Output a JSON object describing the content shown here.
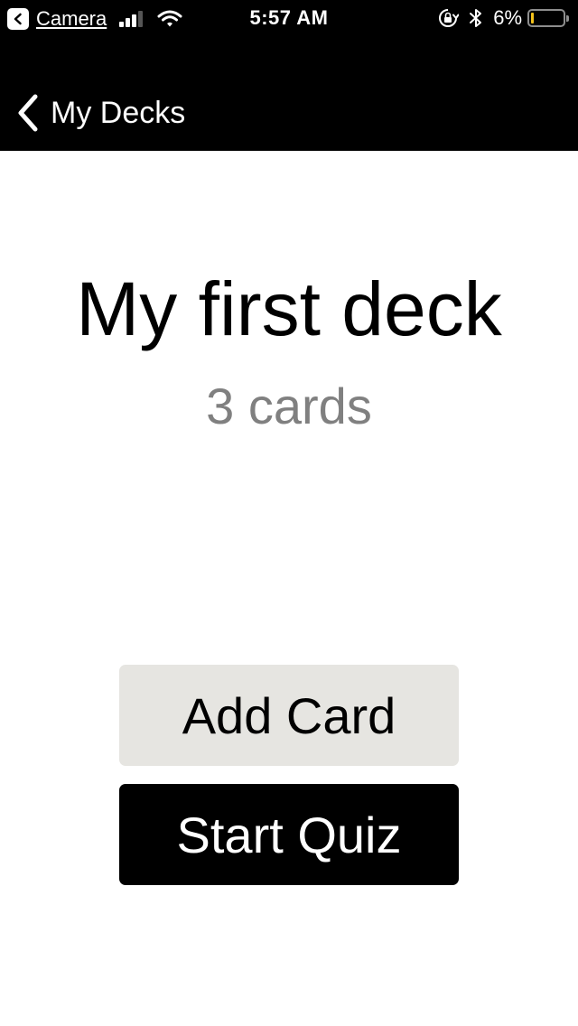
{
  "status_bar": {
    "back_app": "Camera",
    "time": "5:57 AM",
    "battery_percent": "6%",
    "battery_level": 0.06,
    "signal_bars": 3,
    "colors": {
      "background": "#000000",
      "text": "#ffffff",
      "battery_fill": "#f4c21b"
    }
  },
  "nav": {
    "back_label": "My Decks",
    "icon": "chevron-left-icon"
  },
  "deck": {
    "title": "My first deck",
    "card_count": "3 cards"
  },
  "actions": {
    "add_card_label": "Add Card",
    "start_quiz_label": "Start Quiz",
    "colors": {
      "add_card_bg": "#e6e5e1",
      "start_quiz_bg": "#000000"
    }
  }
}
